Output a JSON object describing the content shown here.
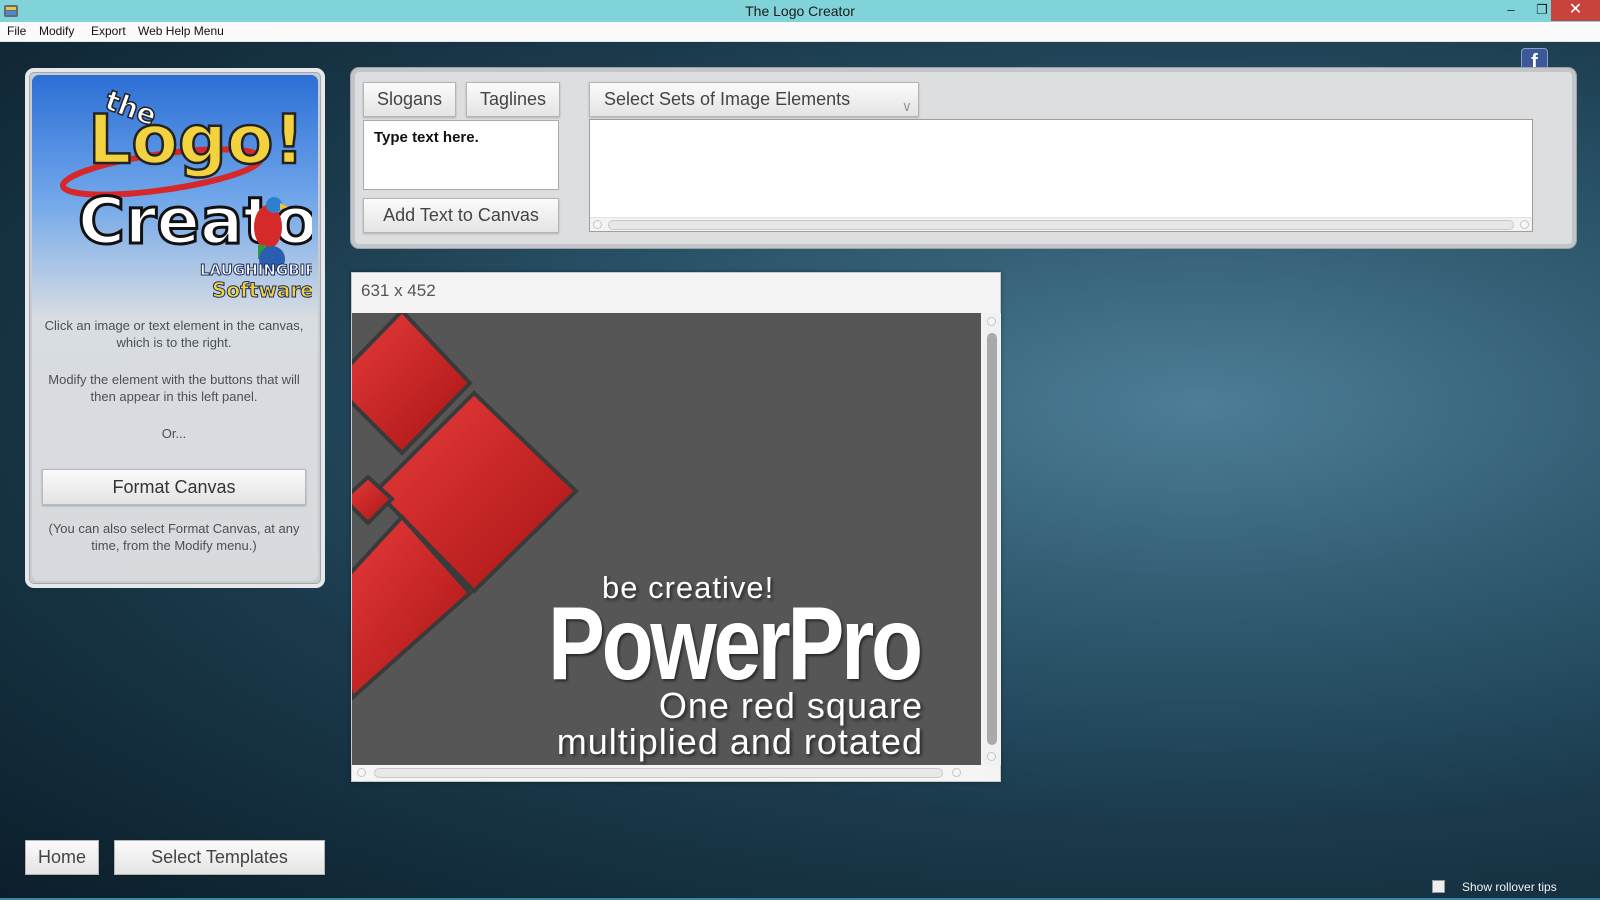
{
  "window": {
    "title": "The Logo Creator",
    "minimize": "–",
    "maximize": "❐",
    "close": "✕"
  },
  "menu": [
    "File",
    "Modify",
    "Export",
    "Web Help Menu"
  ],
  "left_panel": {
    "logo": {
      "the": "the",
      "logo": "Logo!",
      "creator": "Creator",
      "company_1": "LAUGHINGBIRD",
      "company_2": "Software"
    },
    "help_1": "Click an image or text element in the canvas, which is to the right.",
    "help_2": "Modify the element with the buttons that will then appear in this left panel.",
    "or": "Or...",
    "format_canvas_label": "Format Canvas",
    "format_note": "(You can also select Format Canvas, at any time, from the Modify menu.)"
  },
  "toolbar": {
    "slogans_label": "Slogans",
    "taglines_label": "Taglines",
    "image_sets_label": "Select Sets of Image Elements",
    "text_input_value": "Type text here.",
    "add_text_label": "Add Text to Canvas"
  },
  "canvas": {
    "size_label": "631 x 452",
    "tagline": "be creative!",
    "brand": "PowerPro",
    "line1": "One red square",
    "line2": "multiplied and rotated",
    "background_color": "#565656",
    "shape_color": "#d42a2a"
  },
  "bottom": {
    "home_label": "Home",
    "templates_label": "Select Templates",
    "rollover_label": "Show rollover tips"
  },
  "icons": {
    "app": "logo-creator-app-icon",
    "facebook": "facebook-icon",
    "facebook_glyph": "f"
  },
  "colors": {
    "titlebar": "#7fd3d9",
    "close_button": "#c7433b",
    "facebook": "#3b5998"
  }
}
